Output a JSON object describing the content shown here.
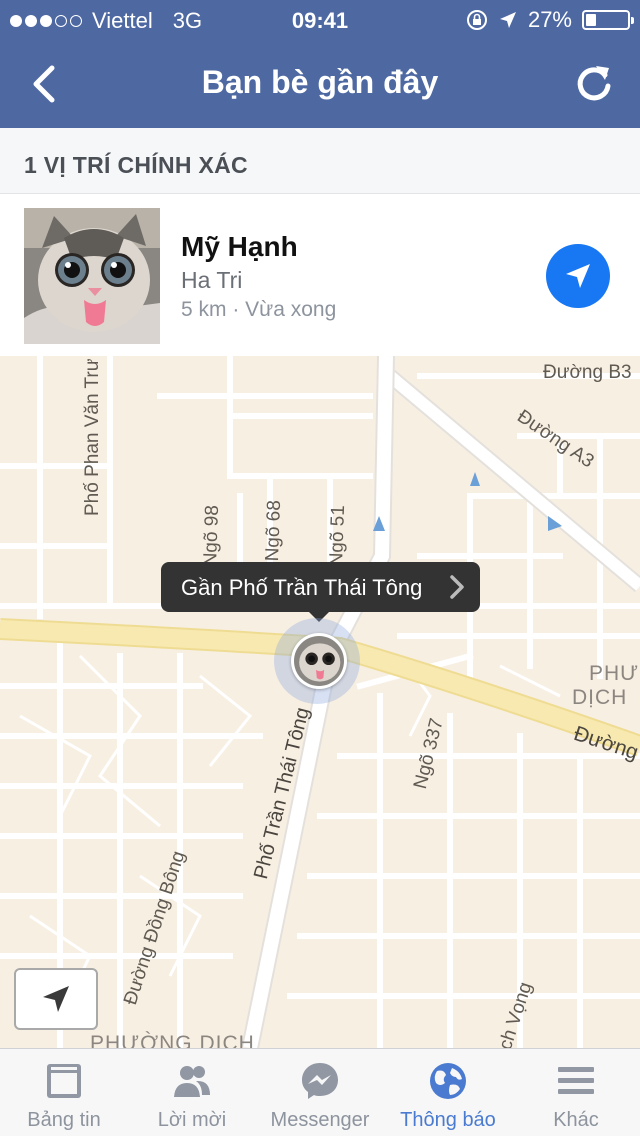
{
  "status_bar": {
    "carrier": "Viettel",
    "network": "3G",
    "time": "09:41",
    "battery": "27%",
    "battery_level": 0.27,
    "signal_bars_filled": 3,
    "signal_bars_total": 5
  },
  "nav": {
    "title": "Bạn bè gần đây",
    "back_icon": "chevron-left-icon",
    "refresh_icon": "refresh-icon"
  },
  "section": {
    "header": "1 VỊ TRÍ CHÍNH XÁC"
  },
  "friend": {
    "name": "Mỹ Hạnh",
    "place": "Ha Tri",
    "meta": "5 km · Vừa xong",
    "directions_icon": "navigation-arrow-icon"
  },
  "map": {
    "tooltip": "Gần Phố Trần Thái Tông",
    "streets": [
      "Phố Phan Văn Trư",
      "Đường B3",
      "Đường A3",
      "Ngõ 98",
      "Ngõ 68",
      "Ngõ 51",
      "Phố Trần Thái Tông",
      "Ngõ 337",
      "Đường",
      "Đường Đồng Bông",
      "ch Vọng"
    ],
    "districts": [
      "PHƯ",
      "DỊCH",
      "PHƯỜNG DỊCH"
    ]
  },
  "tabs": [
    {
      "label": "Bảng tin",
      "icon": "news-feed-icon",
      "active": false
    },
    {
      "label": "Lời mời",
      "icon": "friend-requests-icon",
      "active": false
    },
    {
      "label": "Messenger",
      "icon": "messenger-icon",
      "active": false
    },
    {
      "label": "Thông báo",
      "icon": "globe-icon",
      "active": true
    },
    {
      "label": "Khác",
      "icon": "menu-icon",
      "active": false
    }
  ],
  "colors": {
    "header": "#4e69a2",
    "accent": "#1877f2",
    "map_background": "#f8efe3",
    "main_road": "#f8e9b0",
    "active_tab": "#4a7bd0"
  }
}
